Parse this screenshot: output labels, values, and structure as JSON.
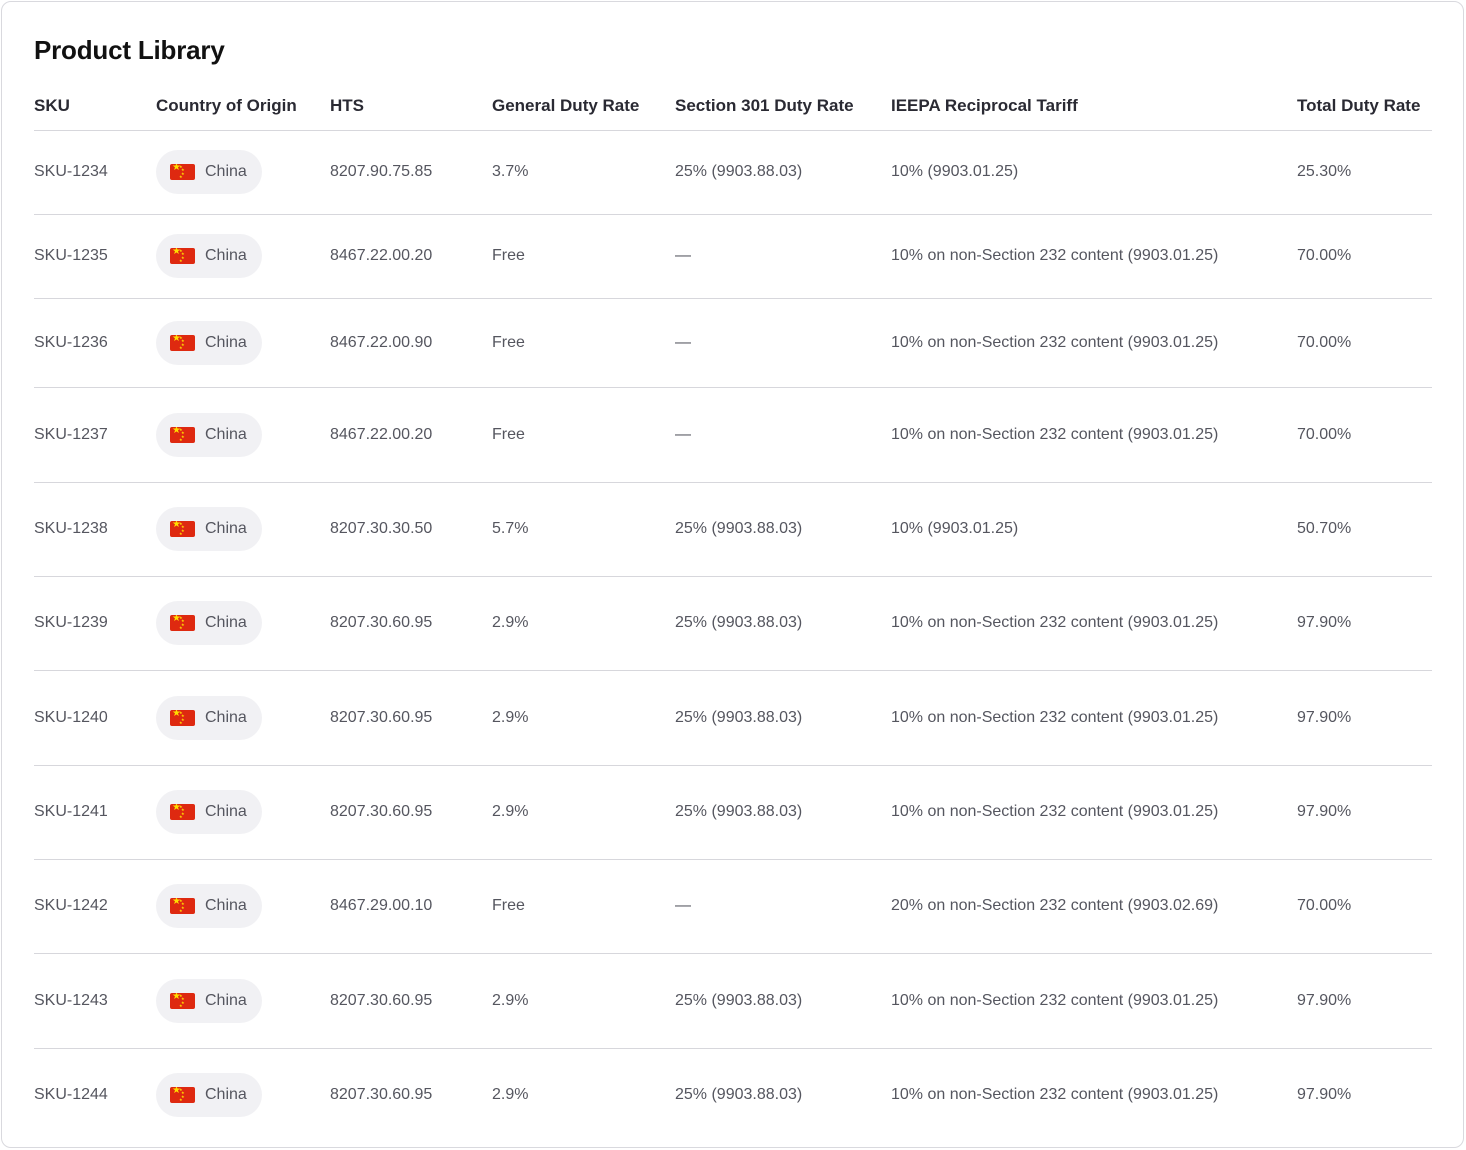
{
  "title": "Product Library",
  "columns": {
    "sku": "SKU",
    "country": "Country of Origin",
    "hts": "HTS",
    "general": "General Duty Rate",
    "section301": "Section 301 Duty Rate",
    "ieepa": "IEEPA Reciprocal Tariff",
    "total": "Total Duty Rate"
  },
  "flag_icon": "china-flag-icon",
  "rows": [
    {
      "sku": "SKU-1234",
      "country": "China",
      "hts": "8207.90.75.85",
      "general": "3.7%",
      "section301": "25% (9903.88.03)",
      "ieepa": "10% (9903.01.25)",
      "total": "25.30%"
    },
    {
      "sku": "SKU-1235",
      "country": "China",
      "hts": "8467.22.00.20",
      "general": "Free",
      "section301": "—",
      "ieepa": "10% on non-Section 232 content (9903.01.25)",
      "total": "70.00%"
    },
    {
      "sku": "SKU-1236",
      "country": "China",
      "hts": "8467.22.00.90",
      "general": "Free",
      "section301": "—",
      "ieepa": "10% on non-Section 232 content (9903.01.25)",
      "total": "70.00%"
    },
    {
      "sku": "SKU-1237",
      "country": "China",
      "hts": "8467.22.00.20",
      "general": "Free",
      "section301": "—",
      "ieepa": "10% on non-Section 232 content (9903.01.25)",
      "total": "70.00%"
    },
    {
      "sku": "SKU-1238",
      "country": "China",
      "hts": "8207.30.30.50",
      "general": "5.7%",
      "section301": "25% (9903.88.03)",
      "ieepa": "10% (9903.01.25)",
      "total": "50.70%"
    },
    {
      "sku": "SKU-1239",
      "country": "China",
      "hts": "8207.30.60.95",
      "general": "2.9%",
      "section301": "25% (9903.88.03)",
      "ieepa": "10% on non-Section 232 content (9903.01.25)",
      "total": "97.90%"
    },
    {
      "sku": "SKU-1240",
      "country": "China",
      "hts": "8207.30.60.95",
      "general": "2.9%",
      "section301": "25% (9903.88.03)",
      "ieepa": "10% on non-Section 232 content (9903.01.25)",
      "total": "97.90%"
    },
    {
      "sku": "SKU-1241",
      "country": "China",
      "hts": "8207.30.60.95",
      "general": "2.9%",
      "section301": "25% (9903.88.03)",
      "ieepa": "10% on non-Section 232 content (9903.01.25)",
      "total": "97.90%"
    },
    {
      "sku": "SKU-1242",
      "country": "China",
      "hts": "8467.29.00.10",
      "general": "Free",
      "section301": "—",
      "ieepa": "20% on non-Section 232 content (9903.02.69)",
      "total": "70.00%"
    },
    {
      "sku": "SKU-1243",
      "country": "China",
      "hts": "8207.30.60.95",
      "general": "2.9%",
      "section301": "25% (9903.88.03)",
      "ieepa": "10% on non-Section 232 content (9903.01.25)",
      "total": "97.90%"
    },
    {
      "sku": "SKU-1244",
      "country": "China",
      "hts": "8207.30.60.95",
      "general": "2.9%",
      "section301": "25% (9903.88.03)",
      "ieepa": "10% on non-Section 232 content (9903.01.25)",
      "total": "97.90%"
    }
  ]
}
